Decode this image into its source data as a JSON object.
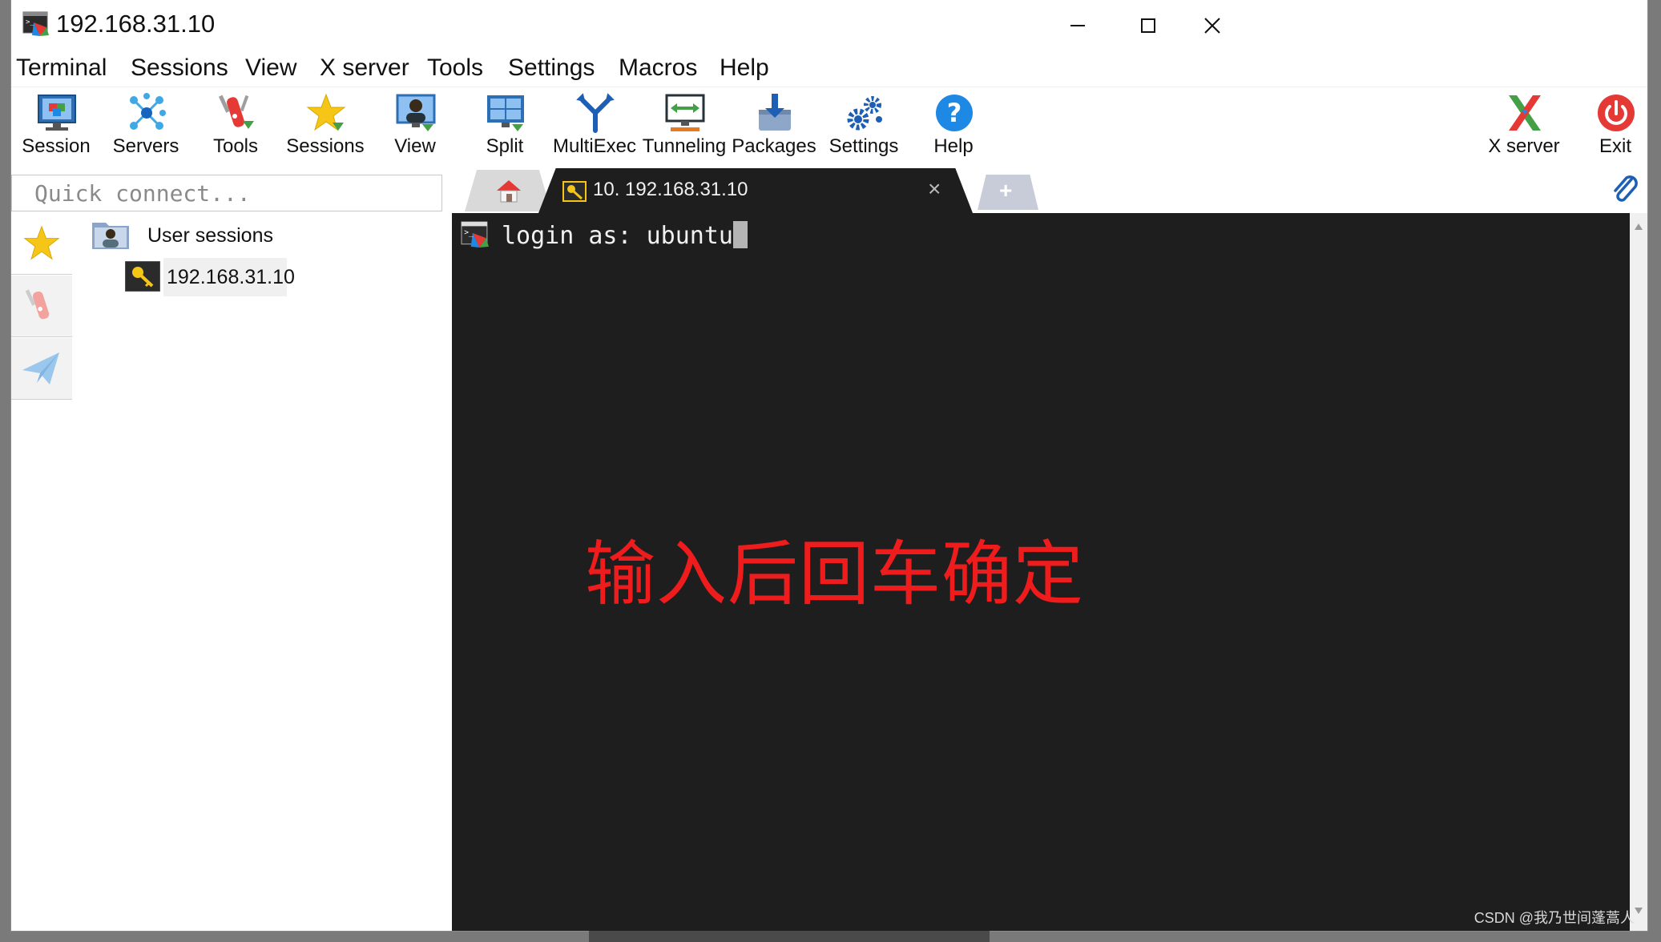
{
  "window": {
    "title": "192.168.31.10",
    "controls": [
      "minimize",
      "maximize",
      "close"
    ]
  },
  "menubar": {
    "items": [
      "Terminal",
      "Sessions",
      "View",
      "X server",
      "Tools",
      "Settings",
      "Macros",
      "Help"
    ]
  },
  "toolbar": {
    "buttons": [
      {
        "label": "Session",
        "icon": "session-monitor-icon"
      },
      {
        "label": "Servers",
        "icon": "servers-network-icon"
      },
      {
        "label": "Tools",
        "icon": "tools-knife-icon"
      },
      {
        "label": "Sessions",
        "icon": "star-icon"
      },
      {
        "label": "View",
        "icon": "view-person-icon"
      },
      {
        "label": "Split",
        "icon": "split-screen-icon"
      },
      {
        "label": "MultiExec",
        "icon": "multiexec-fork-icon"
      },
      {
        "label": "Tunneling",
        "icon": "tunneling-monitor-icon"
      },
      {
        "label": "Packages",
        "icon": "packages-download-icon"
      },
      {
        "label": "Settings",
        "icon": "gears-icon"
      },
      {
        "label": "Help",
        "icon": "help-icon"
      }
    ],
    "right_buttons": [
      {
        "label": "X server",
        "icon": "x-server-icon"
      },
      {
        "label": "Exit",
        "icon": "power-icon"
      }
    ]
  },
  "quick_connect": {
    "placeholder": "Quick connect..."
  },
  "tabs": {
    "active_label": "10. 192.168.31.10",
    "close_symbol": "×",
    "new_tab_symbol": "+"
  },
  "sidebar": {
    "folder_label": "User sessions",
    "session_label": "192.168.31.10"
  },
  "terminal": {
    "prompt": "login as: ",
    "typed": "ubuntu"
  },
  "annotation": {
    "text": "输入后回车确定",
    "color": "#ee1c1c"
  },
  "watermark": "CSDN @我乃世间蓬蒿人",
  "colors": {
    "terminal_bg": "#1e1e1e",
    "accent_blue": "#1e88e5",
    "exit_red": "#e53935",
    "star_yellow": "#f5c518"
  }
}
